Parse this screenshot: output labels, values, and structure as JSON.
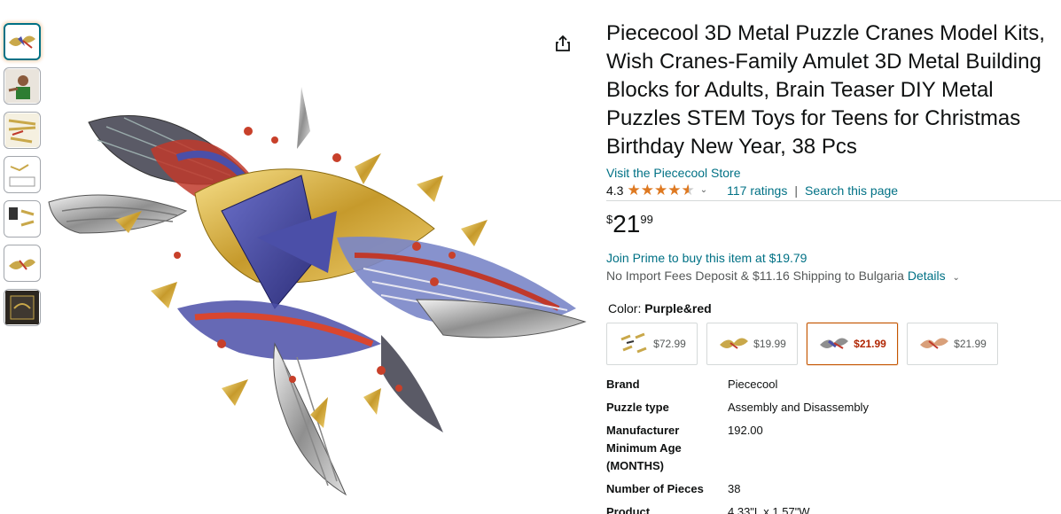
{
  "thumbnails": [
    {
      "name": "crane-thumb-1",
      "selected": true
    },
    {
      "name": "person-thumb",
      "selected": false
    },
    {
      "name": "parts-thumb-1",
      "selected": false
    },
    {
      "name": "diagram-thumb",
      "selected": false
    },
    {
      "name": "parts-thumb-2",
      "selected": false
    },
    {
      "name": "crane-thumb-2",
      "selected": false
    },
    {
      "name": "box-thumb",
      "selected": false
    }
  ],
  "product": {
    "title": "Piececool 3D Metal Puzzle Cranes Model Kits, Wish Cranes-Family Amulet 3D Metal Building Blocks for Adults, Brain Teaser DIY Metal Puzzles STEM Toys for Teens for Christmas Birthday New Year, 38 Pcs",
    "store_link": "Visit the Piececool Store",
    "rating": "4.3",
    "ratings_count": "117 ratings",
    "search_link": "Search this page",
    "price_symbol": "$",
    "price_whole": "21",
    "price_fraction": "99",
    "prime_text": "Join Prime to buy this item at $19.79",
    "import_text": "No Import Fees Deposit & $11.16 Shipping to Bulgaria",
    "details_link": "Details",
    "color_label": "Color:",
    "color_value": "Purple&red"
  },
  "swatches": [
    {
      "price": "$72.99",
      "selected": false
    },
    {
      "price": "$19.99",
      "selected": false
    },
    {
      "price": "$21.99",
      "selected": true
    },
    {
      "price": "$21.99",
      "selected": false
    }
  ],
  "specs": [
    {
      "key": "Brand",
      "value": "Piececool"
    },
    {
      "key": "Puzzle type",
      "value": "Assembly and Disassembly"
    },
    {
      "key": "Manufacturer Minimum Age (MONTHS)",
      "value": "192.00"
    },
    {
      "key": "Number of Pieces",
      "value": "38"
    },
    {
      "key": "Product",
      "value": "4.33\"L x 1.57\"W"
    }
  ],
  "colors": {
    "link": "#007185",
    "star": "#de7921",
    "price_red": "#b12704",
    "selected_border": "#c45500"
  }
}
